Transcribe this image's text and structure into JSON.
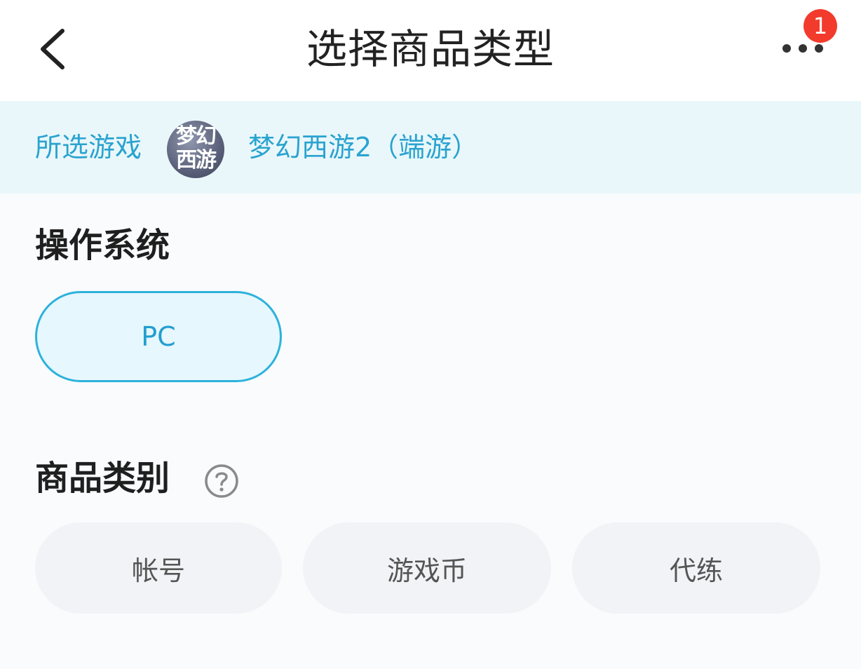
{
  "header": {
    "title": "选择商品类型",
    "back_icon": "chevron-left-icon",
    "more_icon": "more-dots-icon",
    "badge_count": "1"
  },
  "banner": {
    "label": "所选游戏",
    "game_icon_text": "梦幻\n西游",
    "game_name": "梦幻西游2（端游）"
  },
  "os_section": {
    "title": "操作系统",
    "options": [
      {
        "label": "PC",
        "selected": true
      }
    ]
  },
  "category_section": {
    "title": "商品类别",
    "help_icon": "question-circle-icon",
    "options": [
      {
        "label": "帐号"
      },
      {
        "label": "游戏币"
      },
      {
        "label": "代练"
      }
    ]
  },
  "colors": {
    "accent": "#2db2dc",
    "accent_text": "#239ed0",
    "banner_bg": "#e9f7fb",
    "badge": "#f23b2c"
  }
}
